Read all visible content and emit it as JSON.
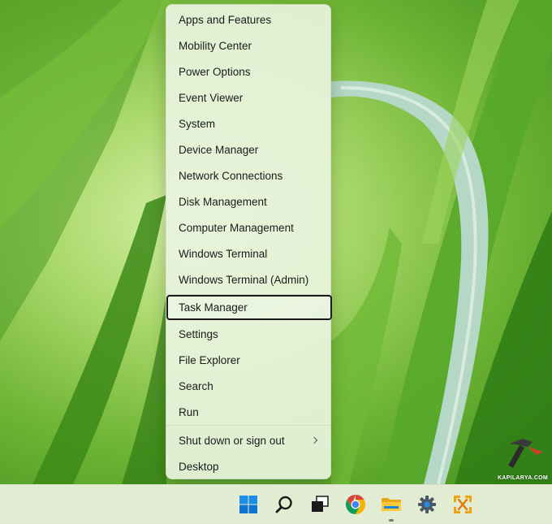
{
  "menu": {
    "items": [
      {
        "label": "Apps and Features"
      },
      {
        "label": "Mobility Center"
      },
      {
        "label": "Power Options"
      },
      {
        "label": "Event Viewer"
      },
      {
        "label": "System"
      },
      {
        "label": "Device Manager"
      },
      {
        "label": "Network Connections"
      },
      {
        "label": "Disk Management"
      },
      {
        "label": "Computer Management"
      },
      {
        "label": "Windows Terminal"
      },
      {
        "label": "Windows Terminal (Admin)"
      },
      {
        "label": "Task Manager",
        "focused": true
      },
      {
        "label": "Settings"
      },
      {
        "label": "File Explorer"
      },
      {
        "label": "Search"
      },
      {
        "label": "Run"
      },
      {
        "label": "Shut down or sign out",
        "has_submenu": true
      },
      {
        "label": "Desktop"
      }
    ]
  },
  "taskbar": {
    "icons": [
      {
        "name": "windows-start-icon"
      },
      {
        "name": "search-icon"
      },
      {
        "name": "task-view-icon"
      },
      {
        "name": "chrome-icon"
      },
      {
        "name": "file-explorer-icon",
        "active": true
      },
      {
        "name": "settings-gear-icon"
      },
      {
        "name": "snipping-tool-icon"
      }
    ]
  },
  "watermark": {
    "text": "KAPILARYA.COM"
  },
  "colors": {
    "accent_blue": "#0067c0",
    "focus_border": "#1a1a1a",
    "taskbar_bg": "#e1ecd2"
  }
}
